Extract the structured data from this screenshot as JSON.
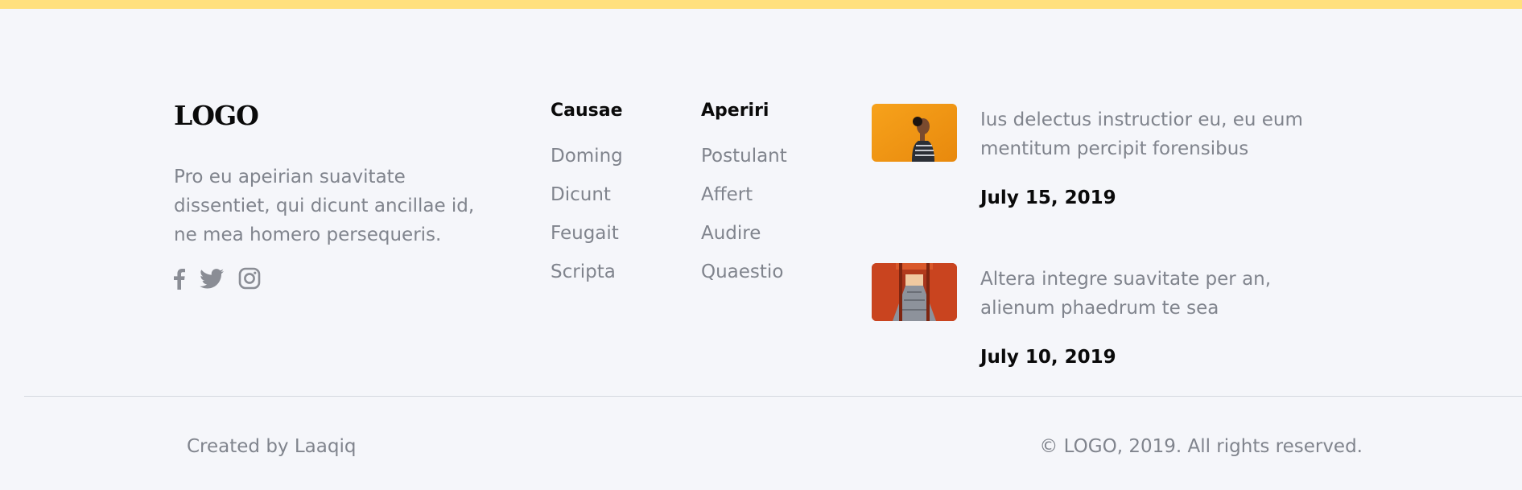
{
  "brand": {
    "logo_text": "LOGO",
    "about": "Pro eu apeirian suavitate dissentiet, qui dicunt ancillae id, ne mea homero persequeris.",
    "accent_color": "#ffe07e",
    "social_icons": [
      "facebook-icon",
      "twitter-icon",
      "instagram-icon"
    ]
  },
  "columns": [
    {
      "title": "Causae",
      "links": [
        "Doming",
        "Dicunt",
        "Feugait",
        "Scripta"
      ]
    },
    {
      "title": "Aperiri",
      "links": [
        "Postulant",
        "Affert",
        "Audire",
        "Quaestio"
      ]
    }
  ],
  "posts": [
    {
      "thumbnail": "woman-profile-orange-wall-photo",
      "excerpt": "Ius delectus instructior eu, eu eum mentitum percipit forensibus",
      "date": "July 15, 2019"
    },
    {
      "thumbnail": "red-torii-gates-corridor-photo",
      "excerpt": "Altera integre suavitate per an, alienum phaedrum te sea",
      "date": "July 10, 2019"
    }
  ],
  "bottom": {
    "credit": "Created by Laaqiq",
    "copyright": "© LOGO, 2019. All rights reserved."
  }
}
